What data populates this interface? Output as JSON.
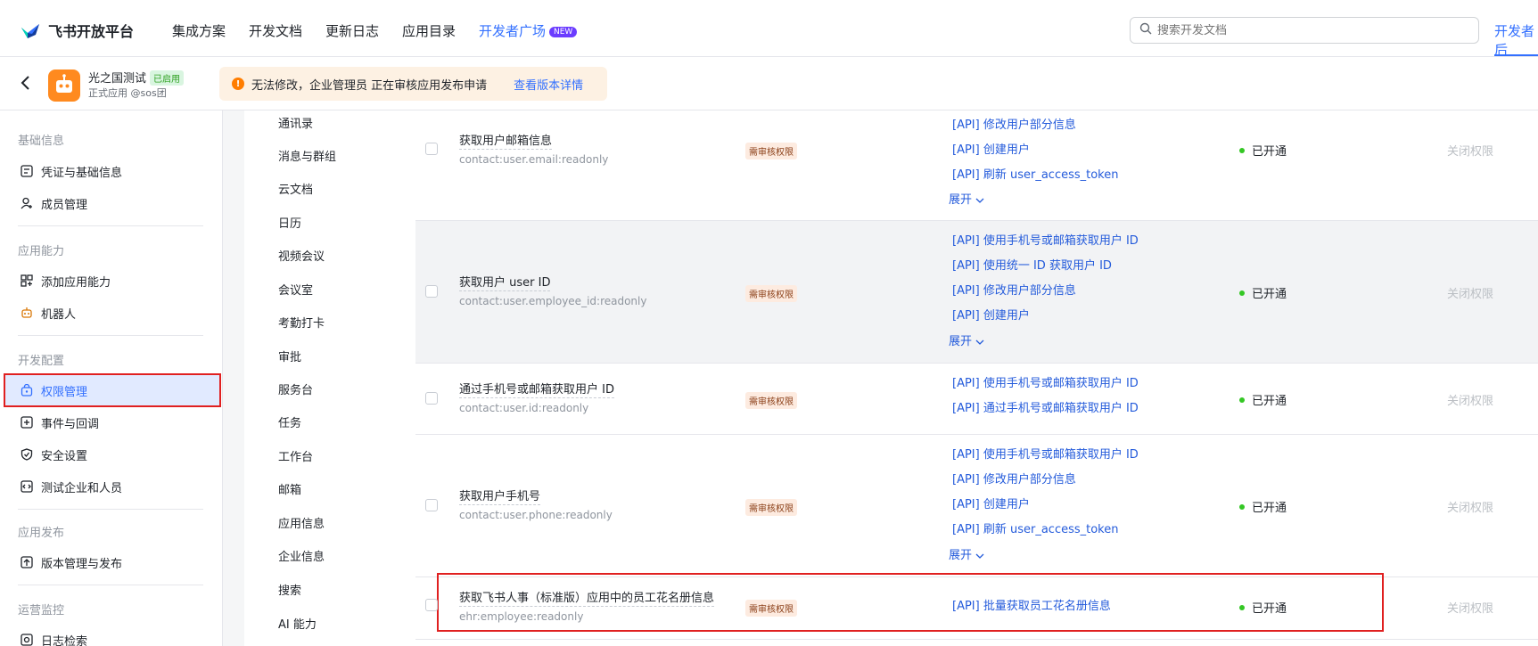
{
  "topnav": {
    "brand": "飞书开放平台",
    "items": [
      {
        "label": "集成方案"
      },
      {
        "label": "开发文档"
      },
      {
        "label": "更新日志"
      },
      {
        "label": "应用目录"
      },
      {
        "label": "开发者广场",
        "active": true,
        "badge": "NEW"
      }
    ],
    "search_placeholder": "搜索开发文档",
    "dev_tab": "开发者后"
  },
  "appbar": {
    "app_name": "光之国测试",
    "status": "已启用",
    "sub": "正式应用 @sos团",
    "notice_text": "无法修改，企业管理员 正在审核应用发布申请",
    "notice_link": "查看版本详情"
  },
  "sidebar": {
    "sections": [
      {
        "title": "基础信息",
        "items": [
          {
            "label": "凭证与基础信息",
            "icon": "credential-icon"
          },
          {
            "label": "成员管理",
            "icon": "member-icon"
          }
        ]
      },
      {
        "title": "应用能力",
        "items": [
          {
            "label": "添加应用能力",
            "icon": "grid-add-icon"
          },
          {
            "label": "机器人",
            "icon": "robot-icon"
          }
        ]
      },
      {
        "title": "开发配置",
        "items": [
          {
            "label": "权限管理",
            "icon": "lock-bag-icon",
            "active": true
          },
          {
            "label": "事件与回调",
            "icon": "event-icon"
          },
          {
            "label": "安全设置",
            "icon": "shield-icon"
          },
          {
            "label": "测试企业和人员",
            "icon": "test-icon"
          }
        ]
      },
      {
        "title": "应用发布",
        "items": [
          {
            "label": "版本管理与发布",
            "icon": "upload-icon"
          }
        ]
      },
      {
        "title": "运营监控",
        "items": [
          {
            "label": "日志检索",
            "icon": "log-search-icon"
          }
        ]
      }
    ]
  },
  "categories": [
    "通讯录",
    "消息与群组",
    "云文档",
    "日历",
    "视频会议",
    "会议室",
    "考勤打卡",
    "审批",
    "服务台",
    "任务",
    "工作台",
    "邮箱",
    "应用信息",
    "企业信息",
    "搜索",
    "AI 能力"
  ],
  "table": {
    "rows": [
      {
        "name": "获取用户邮箱信息",
        "code": "contact:user.email:readonly",
        "tag": "需审核权限",
        "apis": [
          "[API] 修改用户部分信息",
          "[API] 创建用户",
          "[API] 刷新 user_access_token"
        ],
        "expand": "展开",
        "status": "已开通",
        "action": "关闭权限"
      },
      {
        "name": "获取用户 user ID",
        "code": "contact:user.employee_id:readonly",
        "tag": "需审核权限",
        "apis": [
          "[API] 使用手机号或邮箱获取用户 ID",
          "[API] 使用统一 ID 获取用户 ID",
          "[API] 修改用户部分信息",
          "[API] 创建用户"
        ],
        "expand": "展开",
        "status": "已开通",
        "action": "关闭权限"
      },
      {
        "name": "通过手机号或邮箱获取用户 ID",
        "code": "contact:user.id:readonly",
        "tag": "需审核权限",
        "apis": [
          "[API] 使用手机号或邮箱获取用户 ID",
          "[API] 通过手机号或邮箱获取用户 ID"
        ],
        "expand": "",
        "status": "已开通",
        "action": "关闭权限"
      },
      {
        "name": "获取用户手机号",
        "code": "contact:user.phone:readonly",
        "tag": "需审核权限",
        "apis": [
          "[API] 使用手机号或邮箱获取用户 ID",
          "[API] 修改用户部分信息",
          "[API] 创建用户",
          "[API] 刷新 user_access_token"
        ],
        "expand": "展开",
        "status": "已开通",
        "action": "关闭权限"
      },
      {
        "name": "获取飞书人事（标准版）应用中的员工花名册信息",
        "code": "ehr:employee:readonly",
        "tag": "需审核权限",
        "apis": [
          "[API] 批量获取员工花名册信息"
        ],
        "expand": "",
        "status": "已开通",
        "action": "关闭权限"
      }
    ]
  }
}
